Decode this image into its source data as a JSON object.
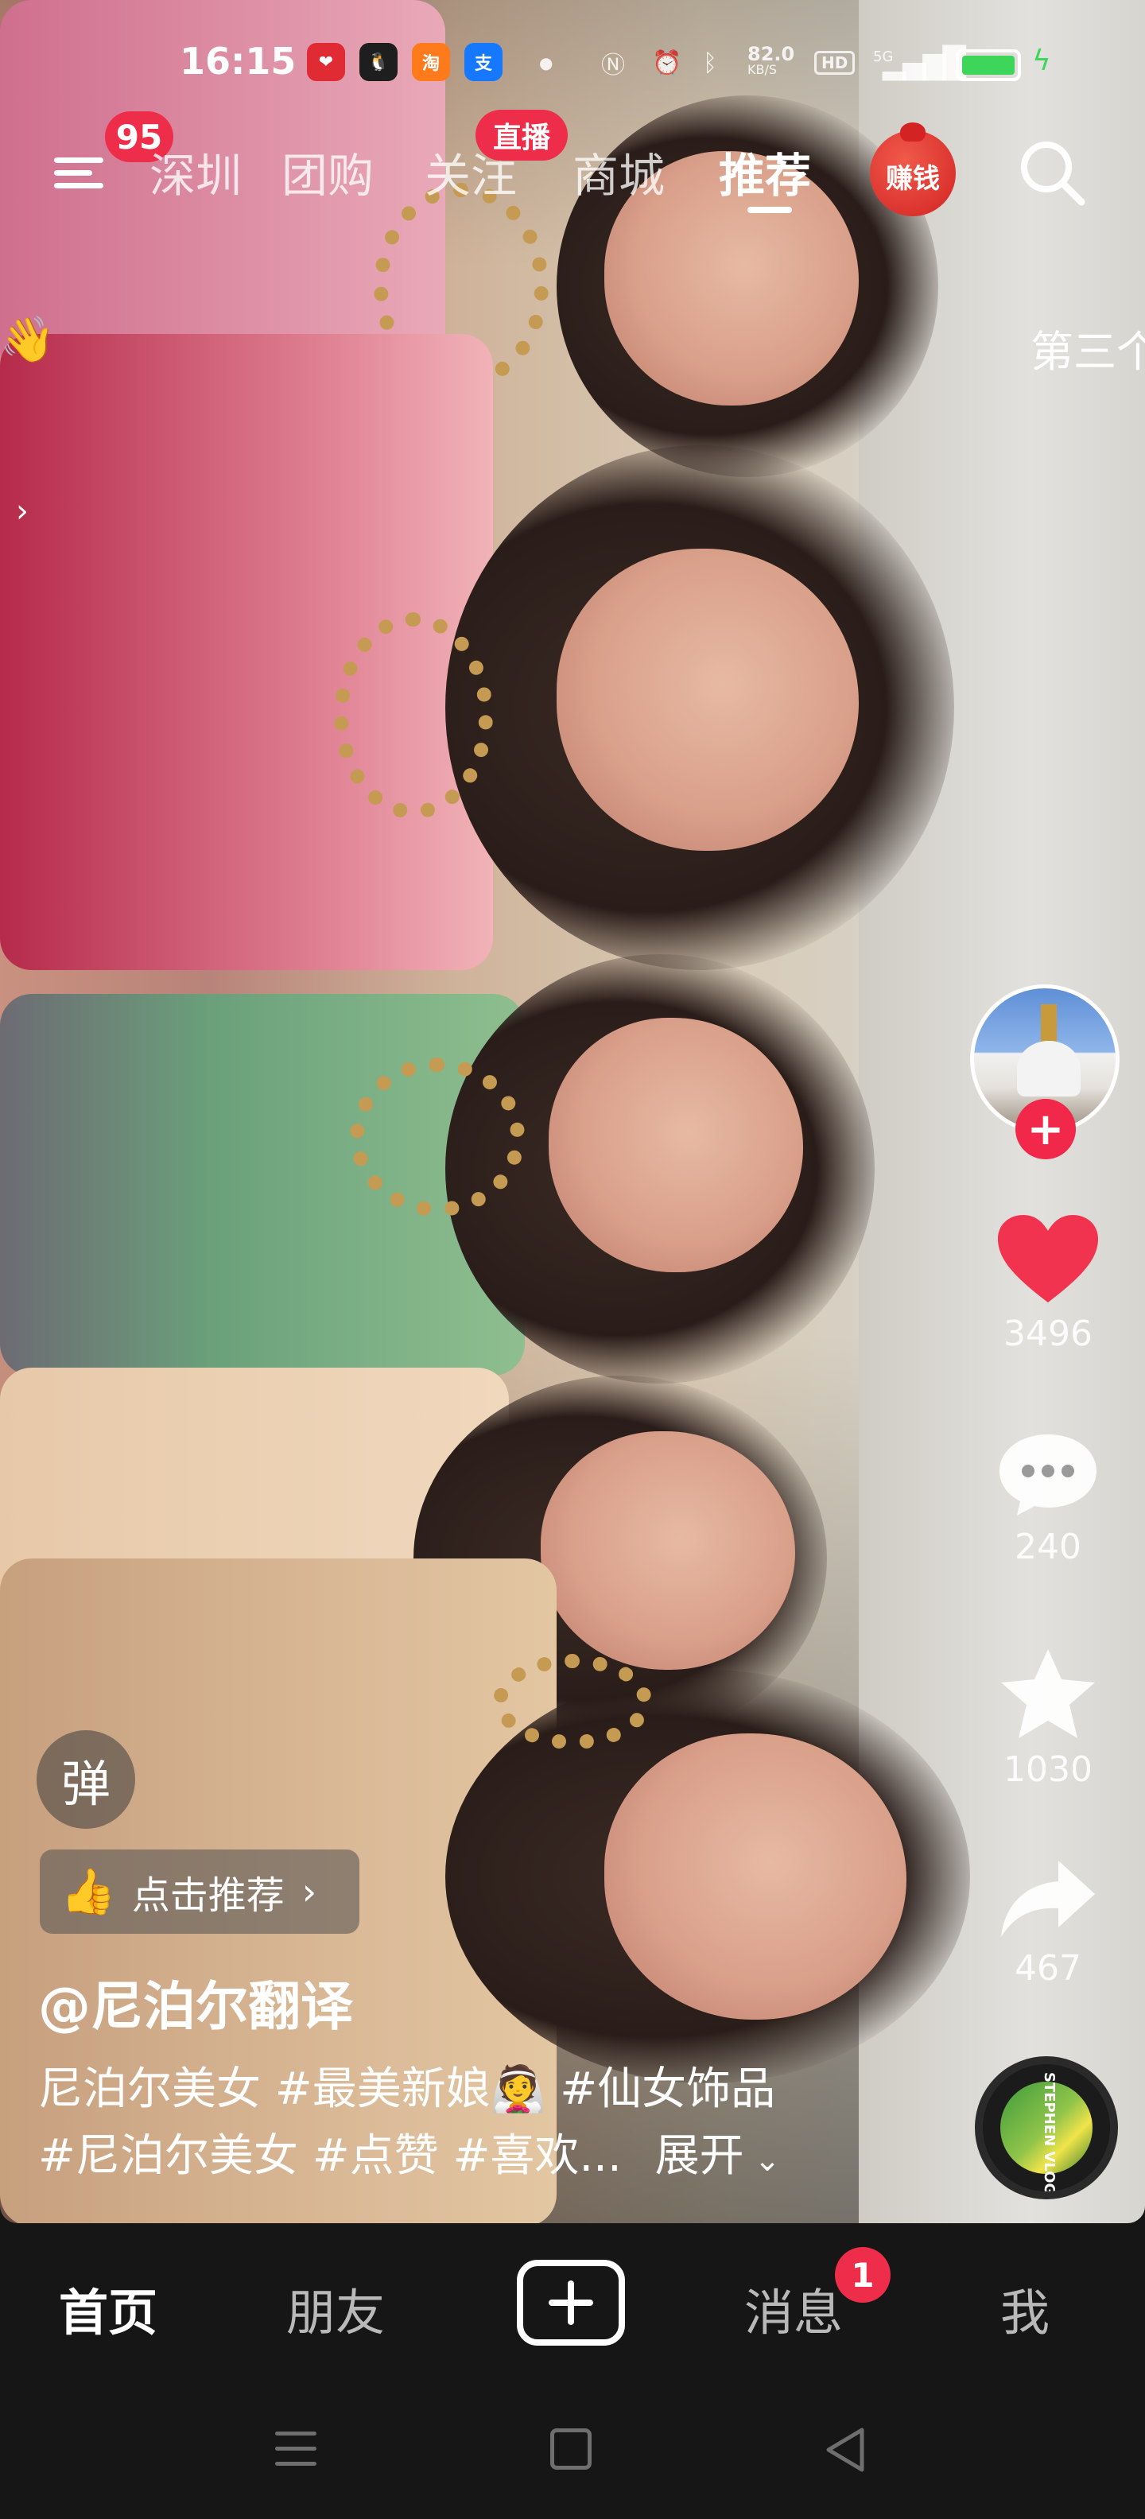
{
  "status_bar": {
    "time": "16:15",
    "apps": [
      "xiaohongshu-app-icon",
      "qq-app-icon",
      "taobao-app-icon",
      "alipay-app-icon"
    ],
    "network_speed_value": "82.0",
    "network_speed_unit": "KB/S",
    "hd_label": "HD",
    "signal_label": "5G",
    "battery_color": "#3ed65a"
  },
  "top_nav": {
    "menu_badge": "95",
    "tabs": [
      "深圳",
      "团购",
      "关注",
      "商城",
      "推荐"
    ],
    "active_tab": "推荐",
    "live_badge": "直播",
    "earn_label": "赚钱"
  },
  "overlay": {
    "side_text": "第三个"
  },
  "actions": {
    "likes": "3496",
    "comments": "240",
    "favorites": "1030",
    "shares": "467",
    "like_color": "#f2334f",
    "follow_color": "#f1284a"
  },
  "video_info": {
    "danmu_label": "弹",
    "recommend_label": "点击推荐",
    "author": "@尼泊尔翻译",
    "desc_line1": "尼泊尔美女 #最美新娘👰 #仙女饰品",
    "desc_line2": "#尼泊尔美女 #点赞 #喜欢...",
    "expand_label": "展开",
    "music_disc_text": "STEPHEN VLOG"
  },
  "bottom_tabs": {
    "home": "首页",
    "friends": "朋友",
    "messages": "消息",
    "messages_badge": "1",
    "me": "我"
  }
}
